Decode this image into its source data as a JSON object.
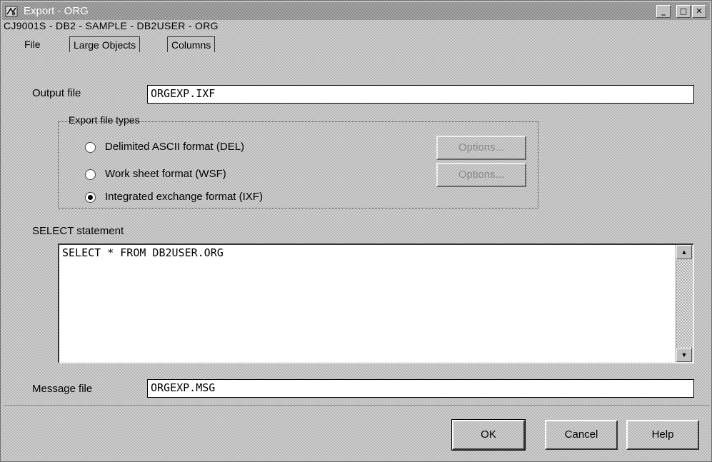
{
  "window": {
    "title": "Export - ORG",
    "subtitle": "CJ9001S - DB2 - SAMPLE - DB2USER - ORG",
    "controls": {
      "minimize": "_",
      "maximize": "□",
      "close": "✕"
    }
  },
  "tabs": [
    {
      "label": "File",
      "selected": true
    },
    {
      "label": "Large Objects",
      "selected": false
    },
    {
      "label": "Columns",
      "selected": false
    }
  ],
  "output_file": {
    "label": "Output file",
    "value": "ORGEXP.IXF"
  },
  "export_types": {
    "title": "Export file types",
    "options": [
      {
        "label": "Delimited ASCII format (DEL)",
        "selected": false
      },
      {
        "label": "Work sheet format (WSF)",
        "selected": false
      },
      {
        "label": "Integrated exchange format (IXF)",
        "selected": true
      }
    ],
    "options_button_1": "Options...",
    "options_button_2": "Options..."
  },
  "select_statement": {
    "label": "SELECT statement",
    "value": "SELECT * FROM DB2USER.ORG"
  },
  "message_file": {
    "label": "Message file",
    "value": "ORGEXP.MSG"
  },
  "buttons": {
    "ok": "OK",
    "cancel": "Cancel",
    "help": "Help"
  },
  "icons": {
    "scroll_up": "▲",
    "scroll_down": "▼"
  }
}
